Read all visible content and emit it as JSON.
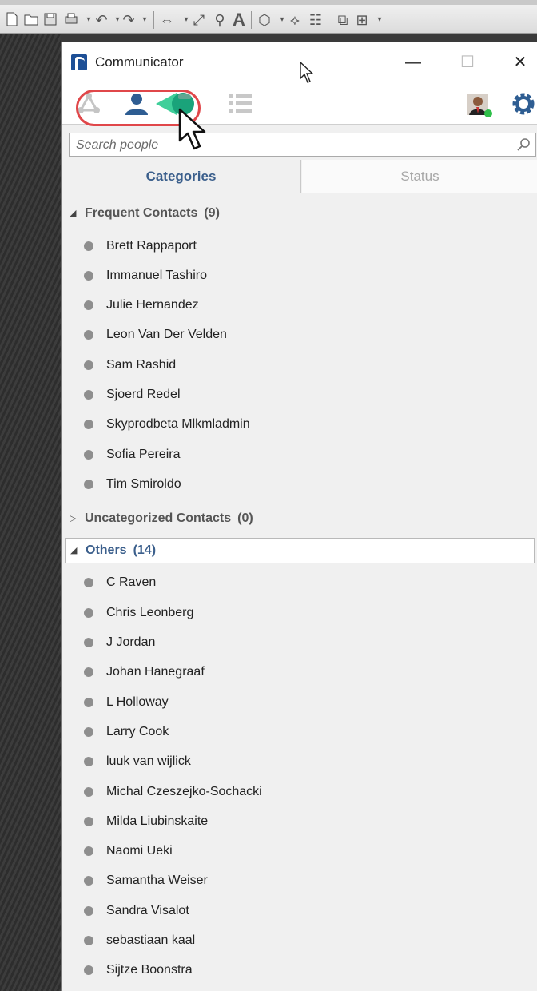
{
  "window": {
    "title": "Communicator",
    "minimize_glyph": "—",
    "maximize_glyph": "☐",
    "close_glyph": "✕"
  },
  "toolbar_icons": [
    "conversations-icon",
    "contacts-icon",
    "calls-icon",
    "list-icon",
    "avatar-icon",
    "settings-icon"
  ],
  "search": {
    "placeholder": "Search people",
    "value": ""
  },
  "tabs": [
    {
      "label": "Categories",
      "active": true
    },
    {
      "label": "Status",
      "active": false
    }
  ],
  "categories": [
    {
      "name": "Frequent Contacts",
      "count": "(9)",
      "expanded": true,
      "contacts": [
        "Brett Rappaport",
        "Immanuel Tashiro",
        "Julie Hernandez",
        "Leon Van Der Velden",
        "Sam Rashid",
        "Sjoerd Redel",
        "Skyprodbeta Mlkmladmin",
        "Sofia Pereira",
        "Tim Smiroldo"
      ]
    },
    {
      "name": "Uncategorized Contacts",
      "count": "(0)",
      "expanded": false,
      "contacts": []
    },
    {
      "name": "Others",
      "count": "(14)",
      "expanded": true,
      "selected": true,
      "contacts": [
        "C Raven",
        "Chris Leonberg",
        "J Jordan",
        "Johan Hanegraaf",
        "L Holloway",
        "Larry Cook",
        "luuk van wijlick",
        "Michal Czeszejko-Sochacki",
        "Milda Liubinskaite",
        "Naomi Ueki",
        "Samantha Weiser",
        "Sandra Visalot",
        "sebastiaan kaal",
        "Sijtze Boonstra"
      ]
    }
  ],
  "colors": {
    "accent": "#3b5f8c",
    "highlight_ring": "#e0474a",
    "presence_offline": "#8e8e8e",
    "presence_online": "#2fbf4a",
    "teal_active": "#1aa37a"
  }
}
